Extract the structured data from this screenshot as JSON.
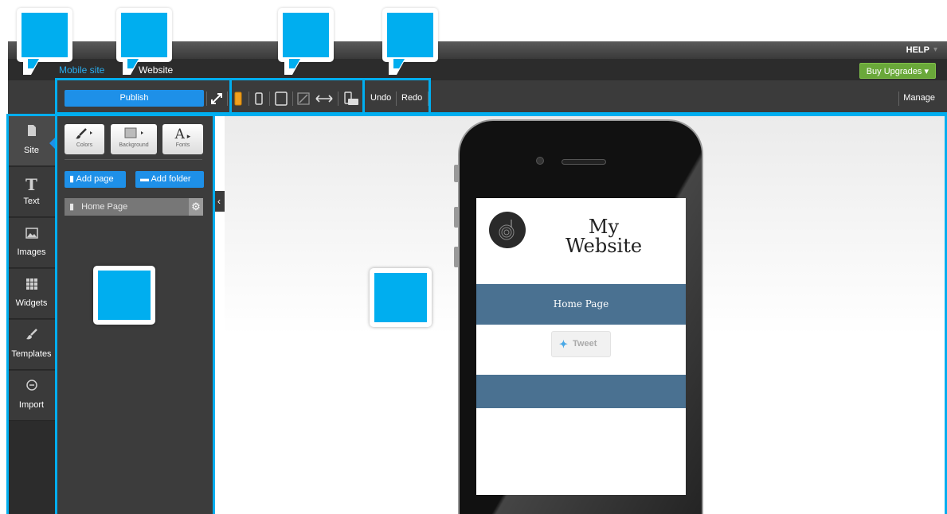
{
  "top_bar": {
    "help_label": "HELP"
  },
  "mode_bar": {
    "tab_mobile": "Mobile site",
    "tab_website": "Website",
    "buy_upgrades": "Buy Upgrades ▾"
  },
  "toolbar": {
    "publish": "Publish",
    "undo": "Undo",
    "redo": "Redo",
    "manage": "Manage",
    "icons": [
      "expand-icon",
      "phone-portrait-icon",
      "phone-icon",
      "tablet-icon",
      "edit-off-icon",
      "resize-width-icon",
      "device-rotate-icon"
    ]
  },
  "sidebar": {
    "items": [
      {
        "label": "Site",
        "icon": "document-icon"
      },
      {
        "label": "Text",
        "icon": "text-icon"
      },
      {
        "label": "Images",
        "icon": "image-icon"
      },
      {
        "label": "Widgets",
        "icon": "grid-icon"
      },
      {
        "label": "Templates",
        "icon": "brush-icon"
      },
      {
        "label": "Import",
        "icon": "import-icon"
      }
    ]
  },
  "panel": {
    "style_buttons": {
      "colors": "Colors",
      "background": "Background",
      "fonts": "Fonts"
    },
    "add_page": "Add page",
    "add_folder": "Add folder",
    "pages": [
      {
        "label": "Home Page"
      }
    ]
  },
  "preview": {
    "site_title_line1": "My",
    "site_title_line2": "Website",
    "nav_item": "Home Page",
    "tweet": "Tweet"
  },
  "colors": {
    "accent": "#00aeef",
    "publish": "#1e90e8",
    "buy": "#6aa83a",
    "site_nav": "#4a7191"
  }
}
